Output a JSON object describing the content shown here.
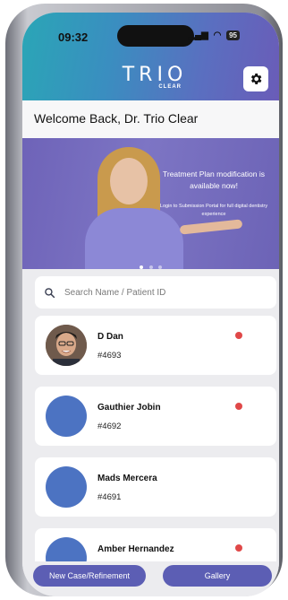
{
  "status_bar": {
    "time": "09:32",
    "signal": "..ll",
    "wifi": "wifi",
    "battery": "95"
  },
  "header": {
    "logo_text": "TRIO",
    "logo_subtext": "CLEAR",
    "settings_icon": "gear-icon"
  },
  "welcome": "Welcome Back, Dr. Trio Clear",
  "banner": {
    "title": "Treatment Plan modification is available now!",
    "subtitle": "Login to Submission Portal for full digital dentistry experience"
  },
  "search": {
    "placeholder": "Search Name / Patient ID",
    "value": ""
  },
  "patients": [
    {
      "name": "D Dan",
      "id": "#4693",
      "status_color": "#e04848",
      "has_photo": true
    },
    {
      "name": "Gauthier Jobin",
      "id": "#4692",
      "status_color": "#e04848",
      "has_photo": false
    },
    {
      "name": "Mads Mercera",
      "id": "#4691",
      "status_color": null,
      "has_photo": false
    },
    {
      "name": "Amber Hernandez",
      "id": "",
      "status_color": "#e04848",
      "has_photo": false
    }
  ],
  "buttons": {
    "new_case": "New Case/Refinement",
    "gallery": "Gallery"
  },
  "colors": {
    "accent": "#5c5eb4",
    "avatar_placeholder": "#4c73c2",
    "status_red": "#e04848"
  }
}
